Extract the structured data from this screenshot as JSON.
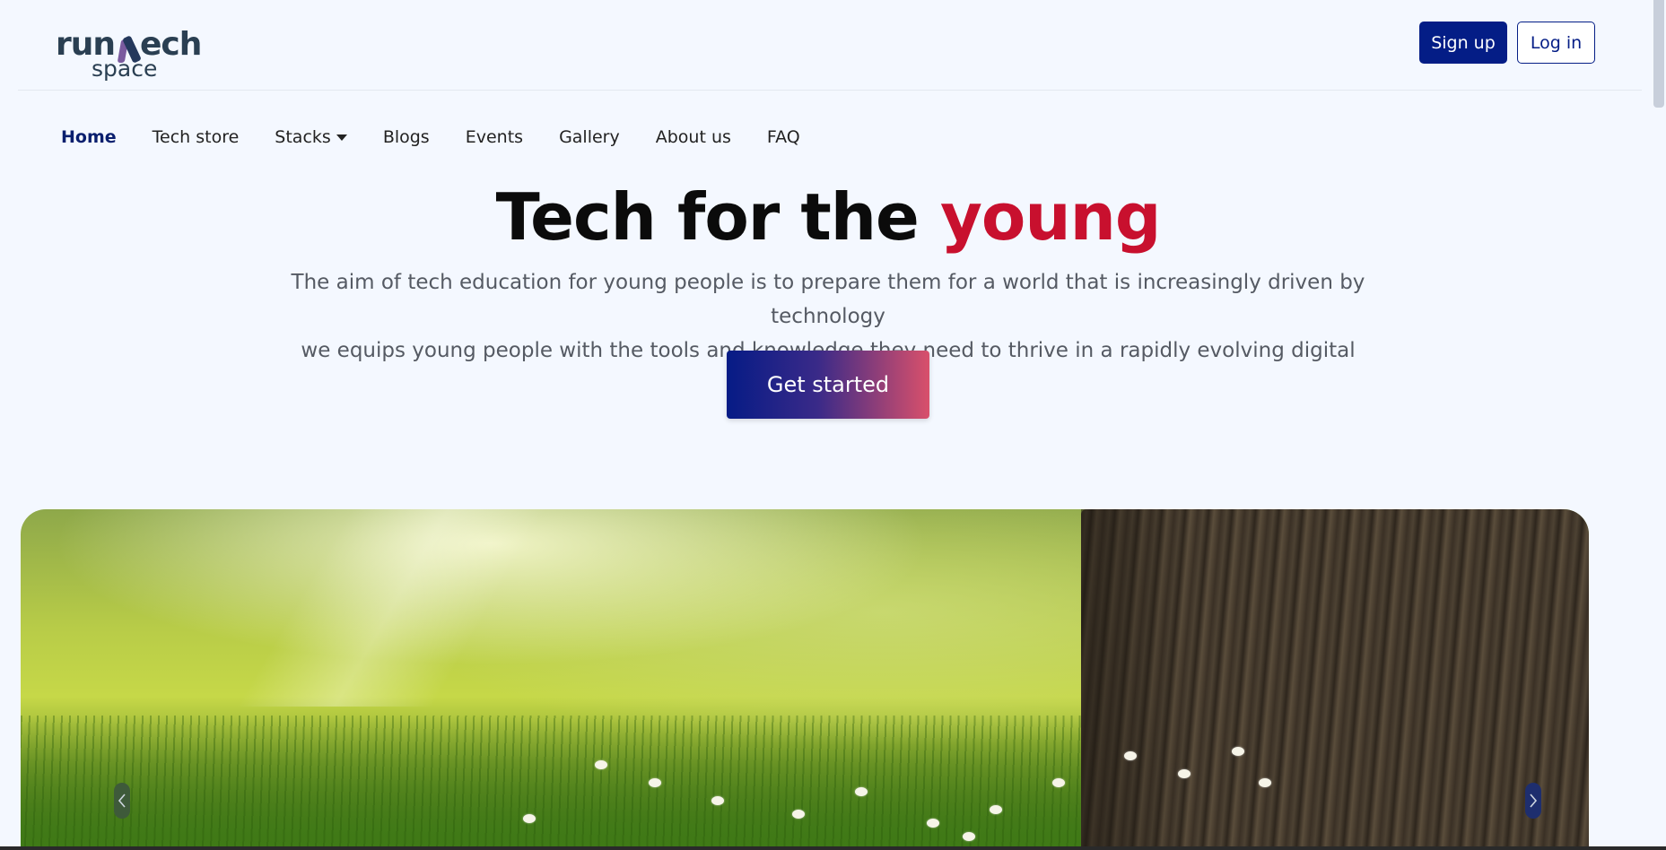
{
  "logo": {
    "top": "run",
    "tech": "ech",
    "bottom": "space"
  },
  "header": {
    "signup_label": "Sign up",
    "login_label": "Log in"
  },
  "nav": {
    "items": [
      {
        "label": "Home",
        "active": true
      },
      {
        "label": "Tech store"
      },
      {
        "label": "Stacks",
        "dropdown": true
      },
      {
        "label": "Blogs"
      },
      {
        "label": "Events"
      },
      {
        "label": "Gallery"
      },
      {
        "label": "About us"
      },
      {
        "label": "FAQ"
      }
    ]
  },
  "hero": {
    "title_main": "Tech for the ",
    "title_accent": "young",
    "subtitle_line1": "The aim of tech education for young people is to prepare them for a world that is increasingly driven by technology",
    "subtitle_line2": "we equips young people with the tools and knowledge they need to thrive in a rapidly evolving digital landscape.",
    "cta_label": "Get started"
  },
  "carousel": {
    "prev_icon": "chevron-left-icon",
    "next_icon": "chevron-right-icon"
  },
  "colors": {
    "brand_primary": "#041d86",
    "accent_red": "#c8102e",
    "background": "#f4f8ff"
  }
}
